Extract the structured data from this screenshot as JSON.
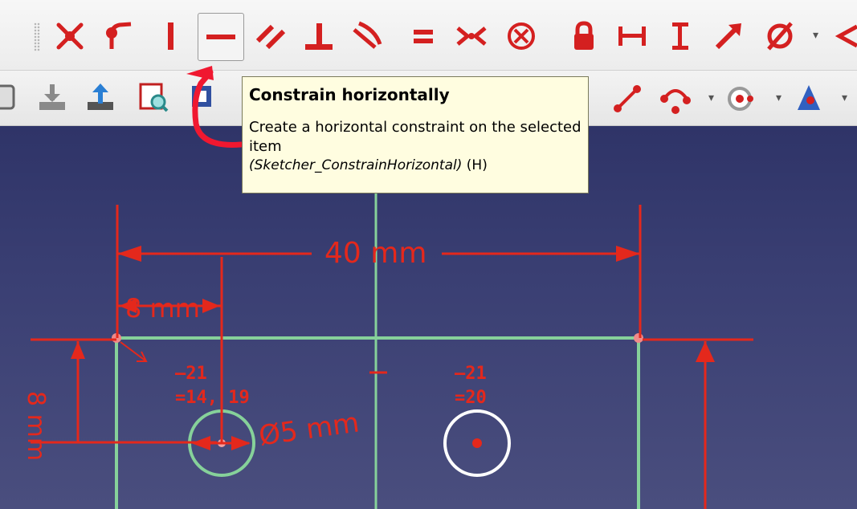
{
  "toolbar_top": {
    "buttons": [
      {
        "name": "constrain-coincident-icon"
      },
      {
        "name": "constrain-point-on-object-icon"
      },
      {
        "name": "constrain-vertical-icon"
      },
      {
        "name": "constrain-horizontal-icon"
      },
      {
        "name": "constrain-parallel-icon"
      },
      {
        "name": "constrain-perpendicular-icon"
      },
      {
        "name": "constrain-tangent-icon"
      },
      {
        "name": "constrain-equal-icon"
      },
      {
        "name": "constrain-symmetric-icon"
      },
      {
        "name": "constrain-block-icon"
      },
      {
        "name": "constrain-lock-icon"
      },
      {
        "name": "constrain-horizontal-distance-icon"
      },
      {
        "name": "constrain-vertical-distance-icon"
      },
      {
        "name": "constrain-distance-icon"
      },
      {
        "name": "constrain-diameter-icon"
      },
      {
        "name": "constrain-angle-icon"
      }
    ],
    "accent_color": "#d42020"
  },
  "toolbar_second": {
    "left_icons": [
      "partial-icon",
      "save-icon",
      "upload-icon",
      "zoom-selection-icon",
      "view-icon",
      "partial-icon"
    ],
    "right_icons": [
      "line-icon",
      "arc-icon",
      "circle-icon",
      "point-icon"
    ]
  },
  "tooltip": {
    "title": "Constrain horizontally",
    "description": "Create a horizontal constraint on the selected item",
    "command": "(Sketcher_ConstrainHorizontal)",
    "shortcut": "(H)"
  },
  "sketch": {
    "dim_40": "40 mm",
    "dim_8": "8 mm",
    "dim_vertical": "8 mm",
    "dim_diameter": "Ø5 mm",
    "label_left_a": "21",
    "label_left_b": "14, 19",
    "label_right_a": "21",
    "label_right_b": "20",
    "colors": {
      "background_top": "#2f3468",
      "background_bottom": "#4a4e7e",
      "constraint": "#e4281c",
      "geometry": "#86d19a",
      "selected_circle": "#ffffff"
    }
  }
}
